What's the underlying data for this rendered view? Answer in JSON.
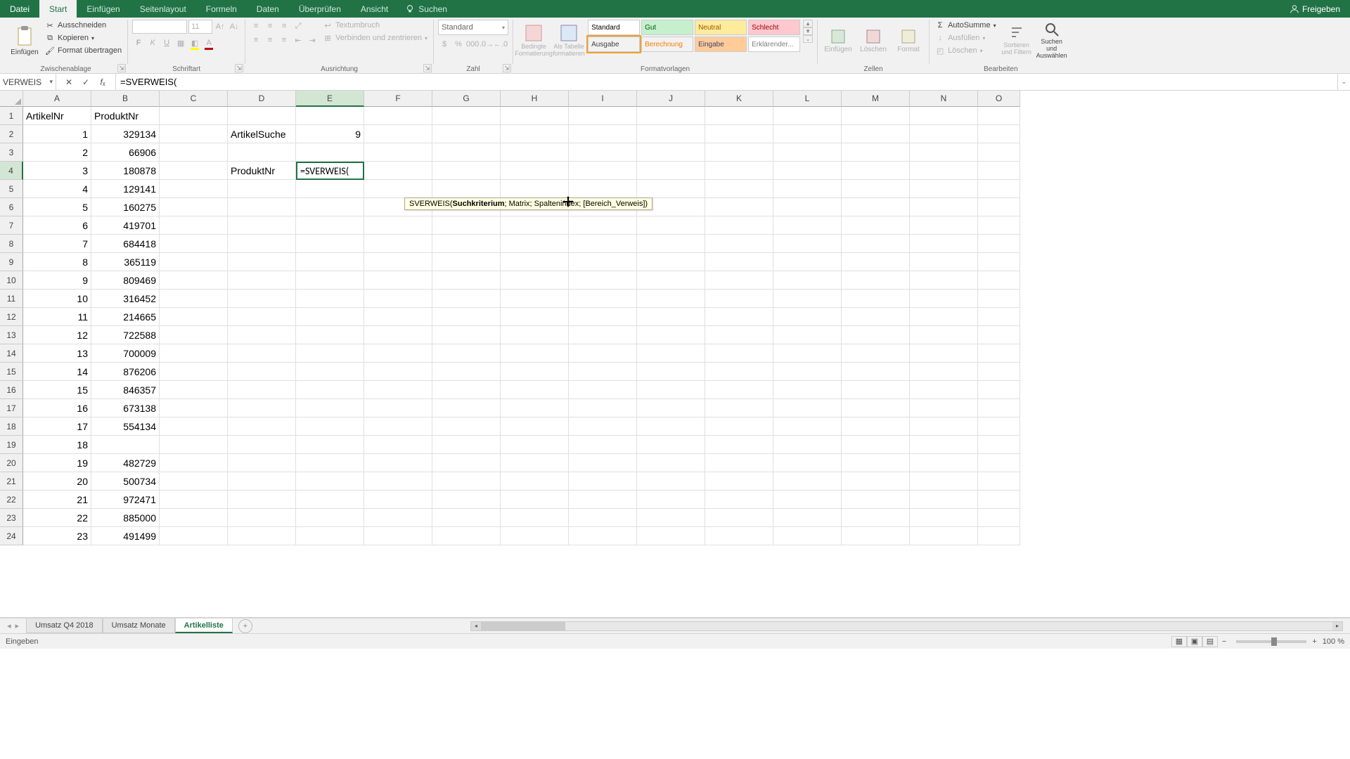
{
  "titlebar": {
    "file": "Datei",
    "tabs": [
      "Start",
      "Einfügen",
      "Seitenlayout",
      "Formeln",
      "Daten",
      "Überprüfen",
      "Ansicht"
    ],
    "active_tab": "Start",
    "tellme": "Suchen",
    "share": "Freigeben"
  },
  "ribbon": {
    "clipboard": {
      "paste": "Einfügen",
      "cut": "Ausschneiden",
      "copy": "Kopieren",
      "fmtpaint": "Format übertragen",
      "title": "Zwischenablage"
    },
    "font": {
      "name": "",
      "size": "11",
      "b": "F",
      "i": "K",
      "u": "U",
      "title": "Schriftart"
    },
    "align": {
      "wrap": "Textumbruch",
      "merge": "Verbinden und zentrieren",
      "title": "Ausrichtung"
    },
    "number": {
      "format": "Standard",
      "title": "Zahl"
    },
    "styles": {
      "cond": "Bedingte Formatierung",
      "table": "Als Tabelle formatieren",
      "cells": [
        {
          "label": "Standard",
          "bg": "#ffffff",
          "fg": "#000"
        },
        {
          "label": "Gut",
          "bg": "#c6efce",
          "fg": "#006100"
        },
        {
          "label": "Neutral",
          "bg": "#ffeb9c",
          "fg": "#9c5700"
        },
        {
          "label": "Schlecht",
          "bg": "#ffc7ce",
          "fg": "#9c0006"
        },
        {
          "label": "Ausgabe",
          "bg": "#f2f2f2",
          "fg": "#3f3f3f"
        },
        {
          "label": "Berechnung",
          "bg": "#f2f2f2",
          "fg": "#fa7d00"
        },
        {
          "label": "Eingabe",
          "bg": "#ffcc99",
          "fg": "#3f3f76"
        },
        {
          "label": "Erklärender...",
          "bg": "#ffffff",
          "fg": "#7f7f7f"
        }
      ],
      "title": "Formatvorlagen"
    },
    "cells_grp": {
      "insert": "Einfügen",
      "delete": "Löschen",
      "format": "Format",
      "title": "Zellen"
    },
    "editing": {
      "sum": "AutoSumme",
      "fill": "Ausfüllen",
      "clear": "Löschen",
      "sort": "Sortieren und Filtern",
      "find": "Suchen und Auswählen",
      "title": "Bearbeiten"
    }
  },
  "namebox": "VERWEIS",
  "formula": "=SVERWEIS(",
  "tooltip": {
    "fn": "SVERWEIS(",
    "arg_active": "Suchkriterium",
    "rest": "; Matrix; Spaltenindex; [Bereich_Verweis])"
  },
  "columns": [
    "A",
    "B",
    "C",
    "D",
    "E",
    "F",
    "G",
    "H",
    "I",
    "J",
    "K",
    "L",
    "M",
    "N",
    "O"
  ],
  "active_col": "E",
  "active_row": 4,
  "rows": 24,
  "data": {
    "headers": {
      "A1": "ArtikelNr",
      "B1": "ProduktNr",
      "D2": "ArtikelSuche",
      "D4": "ProduktNr",
      "E2": "9"
    },
    "A": [
      "1",
      "2",
      "3",
      "4",
      "5",
      "6",
      "7",
      "8",
      "9",
      "10",
      "11",
      "12",
      "13",
      "14",
      "15",
      "16",
      "17",
      "18",
      "19",
      "20",
      "21",
      "22",
      "23"
    ],
    "B": [
      "329134",
      "66906",
      "180878",
      "129141",
      "160275",
      "419701",
      "684418",
      "365119",
      "809469",
      "316452",
      "214665",
      "722588",
      "700009",
      "876206",
      "846357",
      "673138",
      "554134",
      "",
      "482729",
      "500734",
      "972471",
      "885000",
      "491499"
    ]
  },
  "edit_cell": "=SVERWEIS(",
  "sheets": [
    "Umsatz Q4 2018",
    "Umsatz Monate",
    "Artikelliste"
  ],
  "active_sheet": "Artikelliste",
  "status": "Eingeben",
  "zoom": "100 %"
}
